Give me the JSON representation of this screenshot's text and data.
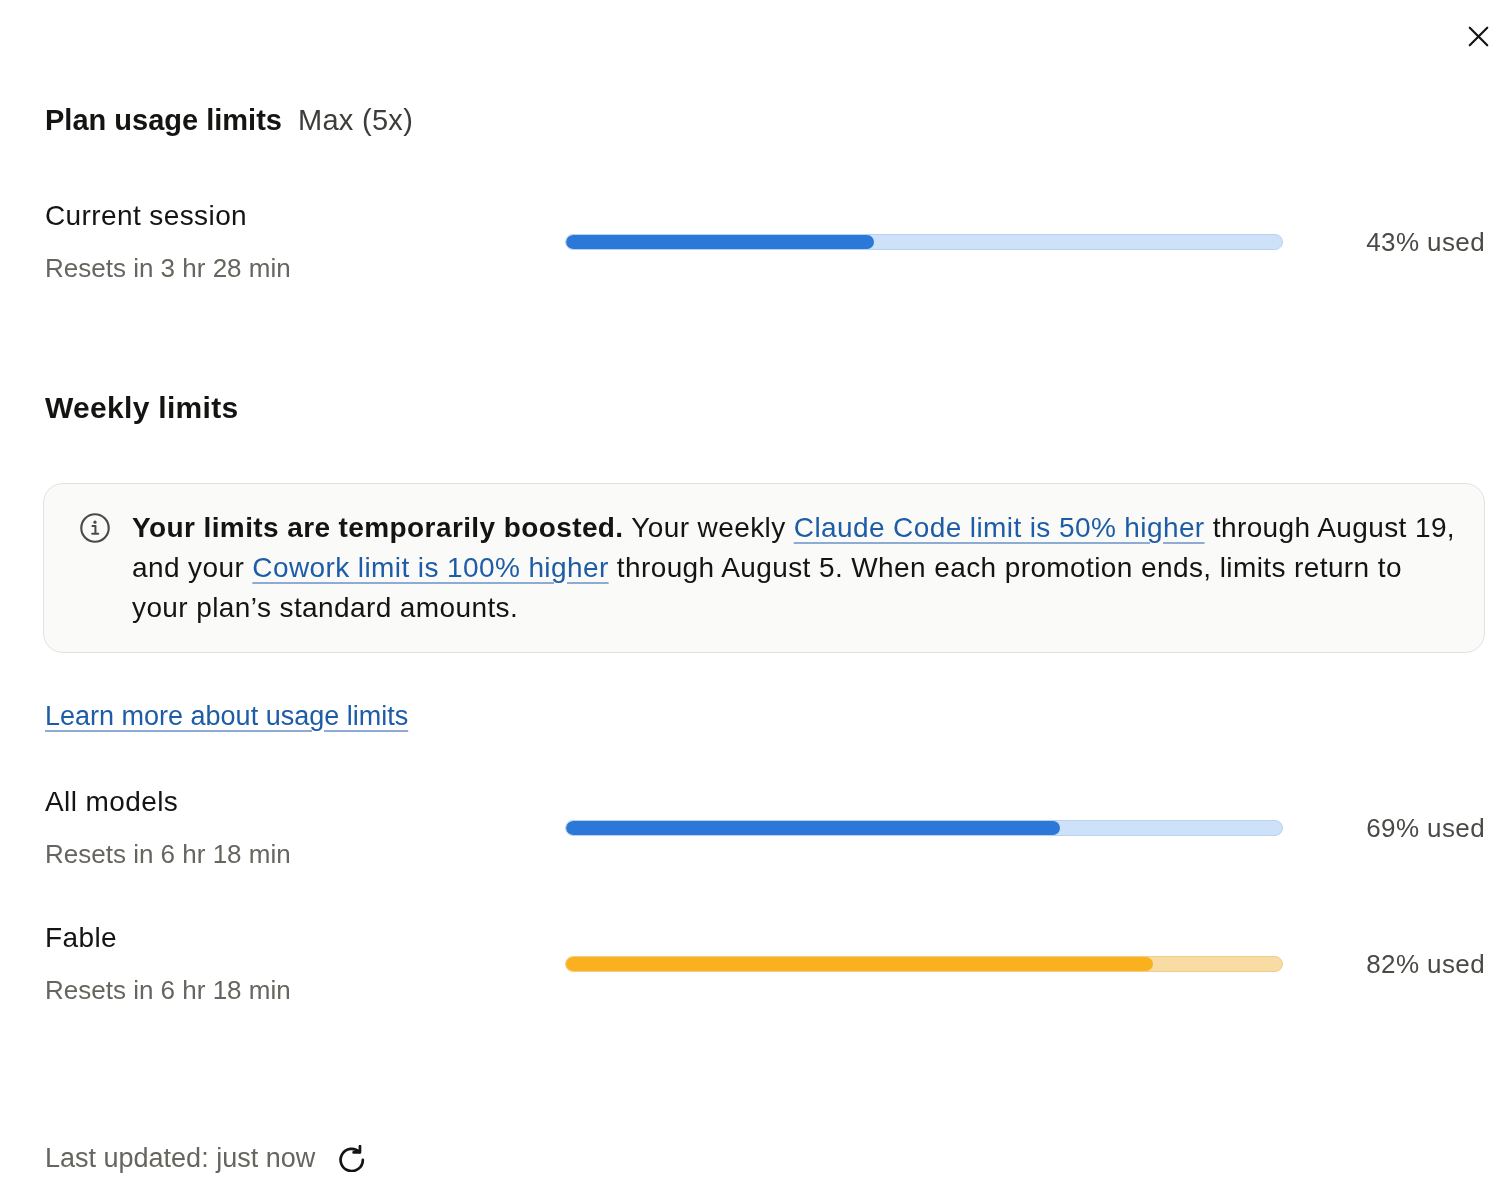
{
  "dialog": {
    "title": "Plan usage limits",
    "plan": "Max (5x)"
  },
  "session": {
    "label": "Current session",
    "reset": "Resets in 3 hr 28 min",
    "level": 0.43,
    "reading": "43% used",
    "warning": false
  },
  "weekly": {
    "title": "Weekly limits",
    "notice": {
      "segments": [
        {
          "kind": "text",
          "text": "**Your limits are temporarily boosted.** Your weekly "
        },
        {
          "kind": "link",
          "text": "Claude Code limit is 50% higher"
        },
        {
          "kind": "text",
          "text": " through August 19, and your "
        },
        {
          "kind": "link",
          "text": "Cowork limit is 100% higher"
        },
        {
          "kind": "text",
          "text": " through August 5. When each promotion ends, limits return to your plan’s standard amounts."
        }
      ]
    },
    "learn_more_link": "Learn more about usage limits",
    "items": [
      {
        "label": "All models",
        "reset": "Resets in 6 hr 18 min",
        "level": 0.69,
        "reading": "69% used",
        "warning": false
      },
      {
        "label": "Fable",
        "reset": "Resets in 6 hr 18 min",
        "level": 0.82,
        "reading": "82% used",
        "warning": true
      }
    ]
  },
  "footer": {
    "last_updated": "Last updated: just now"
  }
}
